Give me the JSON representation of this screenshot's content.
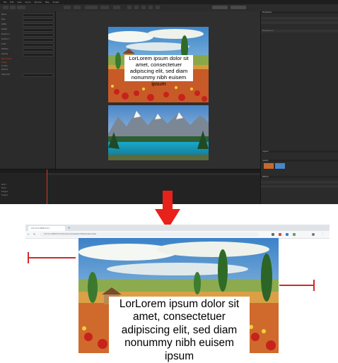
{
  "editor": {
    "menu": [
      "File",
      "Edit",
      "View",
      "Scene",
      "Window",
      "Help",
      "Project"
    ],
    "left_panel": {
      "rows": [
        "Name",
        "Type",
        "Width",
        "Height",
        "Position X",
        "Position Y",
        "Scale",
        "Rotation",
        "Opacity",
        "Blend Mode",
        "Visible",
        "Locked",
        "Shadow",
        "Alignment"
      ]
    },
    "right_panel": {
      "sections": [
        "Properties",
        "Background",
        "Layers",
        "Assets",
        "Effects"
      ]
    },
    "timeline": {
      "rows": [
        "Text 1",
        "Text 2",
        "Image 1",
        "Image 2"
      ]
    }
  },
  "artwork_caption": "LorLorem ipsum dolor sit amet, consectetuer adipiscing elit, sed diam nonummy nibh euisem ipsum",
  "browser": {
    "tab_title": "127.0.0.1:8000/?id=1",
    "url": "127.0.0.1:8000/?id=1&mode=preview&size=fit&autoplay=false"
  },
  "colors": {
    "arrow": "#e8211b",
    "red_marker": "#d22a2a",
    "editor_bg": "#262626"
  }
}
